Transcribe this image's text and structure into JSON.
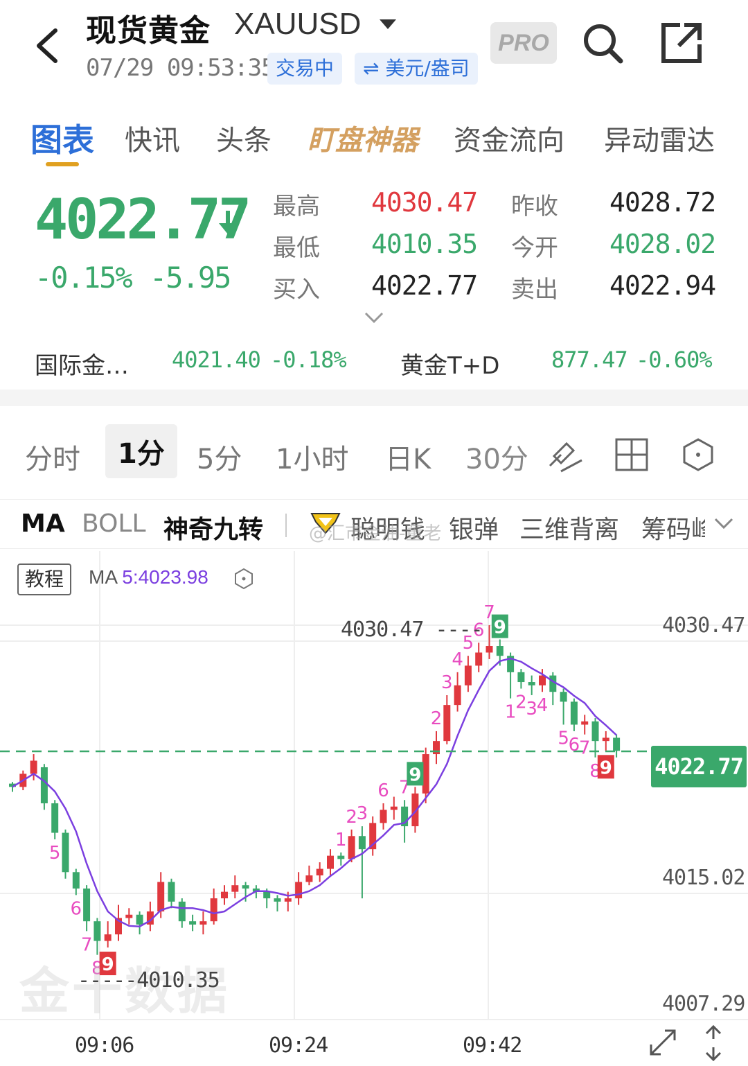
{
  "header": {
    "title": "现货黄金",
    "symbol": "XAUUSD",
    "datetime": "07/29 09:53:35",
    "status": "交易中",
    "unit": "⇌ 美元/盎司",
    "pro": "PRO"
  },
  "tabs": [
    "图表",
    "快讯",
    "头条",
    "盯盘神器",
    "资金流向",
    "异动雷达"
  ],
  "quote": {
    "price": "4022.77",
    "change_pct": "-0.15%",
    "change_abs": "-5.95",
    "high_label": "最高",
    "high": "4030.47",
    "low_label": "最低",
    "low": "4010.35",
    "bid_label": "买入",
    "bid": "4022.77",
    "prev_close_label": "昨收",
    "prev_close": "4028.72",
    "open_label": "今开",
    "open": "4028.02",
    "ask_label": "卖出",
    "ask": "4022.94"
  },
  "related": [
    {
      "name": "国际金…",
      "price": "4021.40",
      "pct": "-0.18%"
    },
    {
      "name": "黄金T+D",
      "price": "877.47",
      "pct": "-0.60%"
    }
  ],
  "periods": [
    "分时",
    "1分",
    "5分",
    "1小时",
    "日K",
    "30分"
  ],
  "indicators": [
    "MA",
    "BOLL",
    "神奇九转",
    "聪明钱",
    "银弹",
    "三维背离",
    "筹码峰"
  ],
  "watermark": "@汇市金油-董老",
  "chart": {
    "tutorial": "教程",
    "ma_label": "MA",
    "ma_value": "5:4023.98",
    "brand": "金十数据",
    "price_tag": "4022.77",
    "high_mark": "4030.47 ----",
    "low_mark": "-----4010.35",
    "colors": {
      "up": "#e0383e",
      "down": "#3aa86b",
      "ma": "#7b3fe0",
      "nine": "#e84cc0"
    }
  },
  "chart_data": {
    "type": "candlestick",
    "y_axis_labels": [
      "4030.47",
      "4015.02",
      "4007.29"
    ],
    "x_axis_labels": [
      "09:06",
      "09:24",
      "09:42"
    ],
    "ylim": [
      4007.29,
      4030.47
    ],
    "last_price": 4022.77,
    "high": 4030.47,
    "low": 4010.35,
    "ma5_latest": 4023.98,
    "candles": [
      [
        4020.8,
        4020.6,
        4020.9,
        4020.3
      ],
      [
        4020.6,
        4021.4,
        4021.6,
        4020.4
      ],
      [
        4021.4,
        4022.2,
        4022.6,
        4021.0
      ],
      [
        4021.8,
        4019.6,
        4022.0,
        4019.2
      ],
      [
        4019.6,
        4017.8,
        4019.8,
        4017.4
      ],
      [
        4017.8,
        4015.4,
        4018.0,
        4015.0
      ],
      [
        4015.4,
        4014.4,
        4015.6,
        4014.0
      ],
      [
        4014.4,
        4012.4,
        4014.6,
        4011.8
      ],
      [
        4012.4,
        4011.2,
        4012.6,
        4010.35
      ],
      [
        4011.2,
        4011.6,
        4012.4,
        4010.8
      ],
      [
        4011.6,
        4012.6,
        4013.4,
        4011.2
      ],
      [
        4012.6,
        4012.8,
        4013.2,
        4012.2
      ],
      [
        4012.8,
        4012.2,
        4013.0,
        4011.6
      ],
      [
        4012.2,
        4013.0,
        4013.6,
        4011.8
      ],
      [
        4013.0,
        4014.8,
        4015.4,
        4012.6
      ],
      [
        4014.8,
        4013.6,
        4015.0,
        4013.2
      ],
      [
        4013.6,
        4012.4,
        4013.8,
        4012.0
      ],
      [
        4012.4,
        4012.2,
        4012.8,
        4011.8
      ],
      [
        4012.2,
        4012.4,
        4013.0,
        4011.6
      ],
      [
        4012.4,
        4013.8,
        4014.4,
        4012.2
      ],
      [
        4013.8,
        4014.2,
        4014.6,
        4013.4
      ],
      [
        4014.2,
        4014.6,
        4015.2,
        4013.8
      ],
      [
        4014.6,
        4014.4,
        4014.8,
        4013.6
      ],
      [
        4014.4,
        4014.2,
        4014.6,
        4013.8
      ],
      [
        4014.2,
        4013.8,
        4014.4,
        4013.2
      ],
      [
        4013.8,
        4013.6,
        4014.0,
        4013.0
      ],
      [
        4013.6,
        4013.8,
        4014.2,
        4013.0
      ],
      [
        4013.8,
        4014.8,
        4015.4,
        4013.4
      ],
      [
        4014.8,
        4015.2,
        4015.8,
        4014.6
      ],
      [
        4015.2,
        4015.6,
        4016.0,
        4014.8
      ],
      [
        4015.6,
        4016.4,
        4016.8,
        4015.2
      ],
      [
        4016.4,
        4016.2,
        4016.6,
        4015.8
      ],
      [
        4016.2,
        4017.6,
        4018.0,
        4016.0
      ],
      [
        4017.6,
        4016.8,
        4018.2,
        4013.8
      ],
      [
        4016.8,
        4018.4,
        4018.8,
        4016.4
      ],
      [
        4018.4,
        4019.2,
        4019.6,
        4018.0
      ],
      [
        4019.2,
        4019.4,
        4020.0,
        4018.6
      ],
      [
        4019.4,
        4018.2,
        4019.8,
        4017.2
      ],
      [
        4018.2,
        4020.2,
        4020.6,
        4017.8
      ],
      [
        4020.2,
        4022.6,
        4023.0,
        4019.6
      ],
      [
        4022.6,
        4023.4,
        4024.0,
        4022.0
      ],
      [
        4023.4,
        4025.6,
        4026.2,
        4023.2
      ],
      [
        4025.6,
        4026.8,
        4027.6,
        4025.2
      ],
      [
        4026.8,
        4028.0,
        4028.6,
        4026.4
      ],
      [
        4028.0,
        4028.8,
        4029.4,
        4027.6
      ],
      [
        4028.8,
        4029.2,
        4030.47,
        4028.4
      ],
      [
        4029.2,
        4028.6,
        4029.6,
        4028.0
      ],
      [
        4028.6,
        4027.6,
        4028.8,
        4026.0
      ],
      [
        4027.6,
        4027.0,
        4027.8,
        4026.6
      ],
      [
        4027.0,
        4026.8,
        4027.4,
        4026.2
      ],
      [
        4026.8,
        4027.4,
        4027.8,
        4026.4
      ],
      [
        4027.4,
        4026.4,
        4027.6,
        4025.6
      ],
      [
        4026.4,
        4025.8,
        4026.6,
        4024.4
      ],
      [
        4025.8,
        4024.4,
        4026.0,
        4024.0
      ],
      [
        4024.4,
        4024.6,
        4025.0,
        4023.8
      ],
      [
        4024.6,
        4023.4,
        4024.8,
        4022.4
      ],
      [
        4023.4,
        4023.6,
        4024.0,
        4022.8
      ],
      [
        4023.6,
        4022.8,
        4023.8,
        4022.4
      ]
    ]
  }
}
